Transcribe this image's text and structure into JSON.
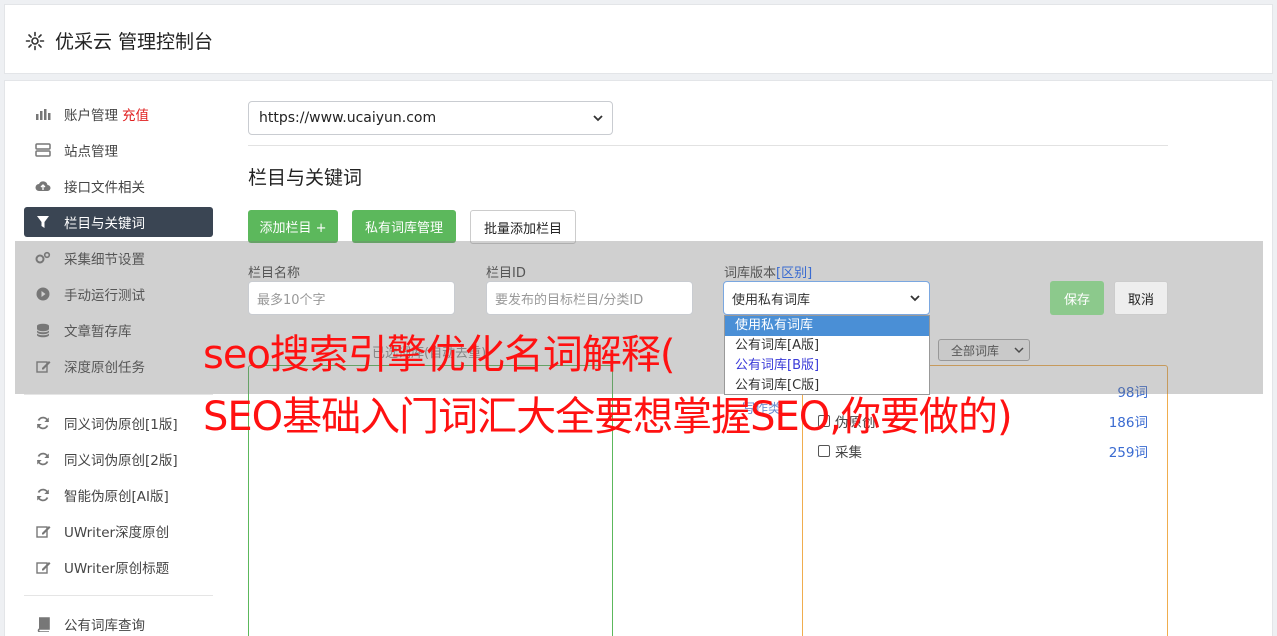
{
  "header": {
    "title": "优采云 管理控制台"
  },
  "sidebar": {
    "items": [
      {
        "label": "账户管理",
        "extra": "充值",
        "icon": "bar-chart-icon"
      },
      {
        "label": "站点管理",
        "icon": "server-icon"
      },
      {
        "label": "接口文件相关",
        "icon": "cloud-upload-icon"
      },
      {
        "label": "栏目与关键词",
        "icon": "filter-icon",
        "active": true
      },
      {
        "label": "采集细节设置",
        "icon": "gears-icon"
      },
      {
        "label": "手动运行测试",
        "icon": "play-icon"
      },
      {
        "label": "文章暂存库",
        "icon": "database-icon"
      },
      {
        "label": "深度原创任务",
        "icon": "edit-icon"
      },
      {
        "label": "同义词伪原创[1版]",
        "icon": "refresh-icon"
      },
      {
        "label": "同义词伪原创[2版]",
        "icon": "refresh-icon"
      },
      {
        "label": "智能伪原创[AI版]",
        "icon": "refresh-icon"
      },
      {
        "label": "UWriter深度原创",
        "icon": "edit-icon"
      },
      {
        "label": "UWriter原创标题",
        "icon": "edit-icon"
      },
      {
        "label": "公有词库查询",
        "icon": "book-icon"
      }
    ]
  },
  "site_select": {
    "value": "https://www.ucaiyun.com"
  },
  "section": {
    "title": "栏目与关键词"
  },
  "toolbar": {
    "add_column": "添加栏目 +",
    "private_lib": "私有词库管理",
    "batch_add": "批量添加栏目"
  },
  "form": {
    "name_label": "栏目名称",
    "name_placeholder": "最多10个字",
    "id_label": "栏目ID",
    "id_placeholder": "要发布的目标栏目/分类ID",
    "lib_label": "词库版本",
    "lib_label_link": "[区别]",
    "lib_value": "使用私有词库",
    "save": "保存",
    "cancel": "取消"
  },
  "dropdown": {
    "options": [
      "使用私有词库",
      "公有词库[A版]",
      "公有词库[B版]",
      "公有词库[C版]"
    ]
  },
  "left_panel": {
    "hint": "已选词库(自动去重)"
  },
  "right_panel": {
    "filter": "全部词库",
    "rows": [
      {
        "label": "",
        "count": "98词"
      },
      {
        "label": "伪原创",
        "count": "186词"
      },
      {
        "label": "采集",
        "count": "259词"
      }
    ],
    "faint_label": "写作类"
  },
  "watermark": {
    "line1": "seo搜索引擎优化名词解释(",
    "line2": "SEO基础入门词汇大全要想掌握SEO,你要做的)"
  }
}
